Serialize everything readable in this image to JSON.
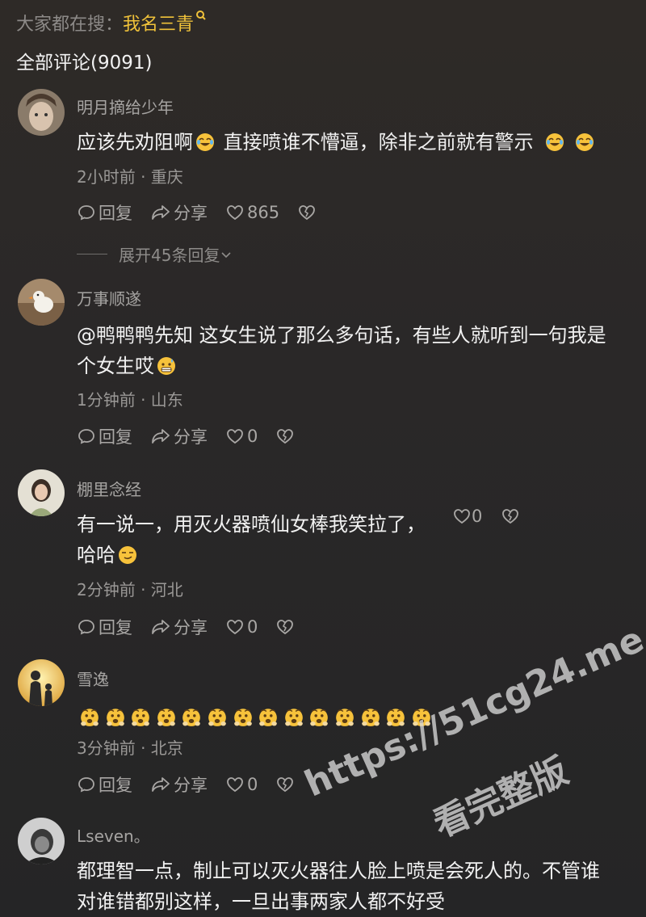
{
  "search_hint": {
    "prefix": "大家都在搜：",
    "keyword": "我名三青",
    "icon": "search-icon"
  },
  "comments_total": "全部评论(9091)",
  "actions": {
    "reply": "回复",
    "share": "分享"
  },
  "comments": [
    {
      "user": "明月摘给少年",
      "line1": "应该先劝阻啊",
      "line1b": " 直接喷谁不懵逼，除非之前就有警示",
      "meta": "2小时前 · 重庆",
      "likes": "865",
      "expand": "展开45条回复"
    },
    {
      "user": "万事顺遂",
      "line1": "@鸭鸭鸭先知  这女生说了那么多句话，有些人就听到一句我是",
      "line2": "个女生哎",
      "meta": "1分钟前 · 山东",
      "likes": "0"
    },
    {
      "user": "棚里念经",
      "line1": "有一说一，用灭火器喷仙女棒我笑拉了，",
      "line2": "哈哈",
      "meta": "2分钟前 · 河北",
      "inline_likes": "0",
      "likes": "0"
    },
    {
      "user": "雪逸",
      "emoji_count": 14,
      "meta": "3分钟前 · 北京",
      "likes": "0"
    },
    {
      "user": "Lseven。",
      "line1": "都理智一点，制止可以灭火器往人脸上喷是会死人的。不管谁",
      "line2": "对谁错都别这样，一旦出事两家人都不好受"
    }
  ],
  "watermark": {
    "line1": "https://51cg24.me",
    "line2": "看完整版"
  },
  "colors": {
    "accent": "#f0c23a",
    "background": "#2a2828"
  }
}
